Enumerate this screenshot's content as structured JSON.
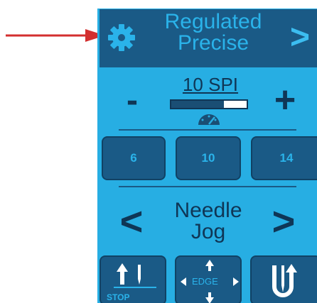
{
  "header": {
    "title_line1": "Regulated",
    "title_line2": "Precise",
    "next_label": ">",
    "icon": "gear-icon"
  },
  "stitch": {
    "minus_label": "-",
    "plus_label": "+",
    "spi_label": "10 SPI",
    "spi_level": 0.7,
    "speed_icon": "speedometer-icon"
  },
  "presets": [
    "6",
    "10",
    "14"
  ],
  "jog": {
    "prev_label": "<",
    "next_label": ">",
    "label_line1": "Needle",
    "label_line2": "Jog"
  },
  "bottom": {
    "stop_label": "STOP",
    "edge_label": "EDGE",
    "needle_icon": "needle-up-icon"
  },
  "colors": {
    "panel": "#27aee3",
    "header": "#1a5a86",
    "text_dark": "#0f3656",
    "text_light": "#2ab3ea",
    "annotation_arrow": "#d32f2f"
  }
}
